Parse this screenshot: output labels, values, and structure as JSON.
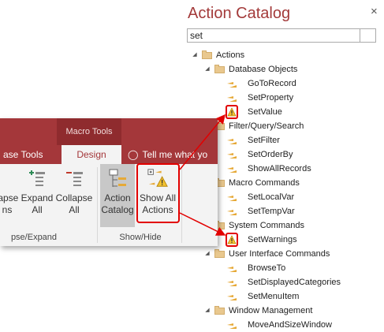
{
  "catalog": {
    "title": "Action Catalog",
    "close_glyph": "×",
    "search_value": "set",
    "tree": [
      {
        "label": "Actions",
        "kind": "folder",
        "level": 0,
        "expanded": true
      },
      {
        "label": "Database Objects",
        "kind": "folder",
        "level": 1,
        "expanded": true
      },
      {
        "label": "GoToRecord",
        "kind": "action",
        "level": 2
      },
      {
        "label": "SetProperty",
        "kind": "action",
        "level": 2
      },
      {
        "label": "SetValue",
        "kind": "action",
        "level": 2,
        "unsafe": true
      },
      {
        "label": "Filter/Query/Search",
        "kind": "folder",
        "level": 1,
        "expanded": true
      },
      {
        "label": "SetFilter",
        "kind": "action",
        "level": 2
      },
      {
        "label": "SetOrderBy",
        "kind": "action",
        "level": 2
      },
      {
        "label": "ShowAllRecords",
        "kind": "action",
        "level": 2
      },
      {
        "label": "Macro Commands",
        "kind": "folder",
        "level": 1,
        "expanded": true
      },
      {
        "label": "SetLocalVar",
        "kind": "action",
        "level": 2
      },
      {
        "label": "SetTempVar",
        "kind": "action",
        "level": 2
      },
      {
        "label": "System Commands",
        "kind": "folder",
        "level": 1,
        "expanded": true
      },
      {
        "label": "SetWarnings",
        "kind": "action",
        "level": 2,
        "unsafe": true
      },
      {
        "label": "User Interface Commands",
        "kind": "folder",
        "level": 1,
        "expanded": true
      },
      {
        "label": "BrowseTo",
        "kind": "action",
        "level": 2
      },
      {
        "label": "SetDisplayedCategories",
        "kind": "action",
        "level": 2
      },
      {
        "label": "SetMenuItem",
        "kind": "action",
        "level": 2
      },
      {
        "label": "Window Management",
        "kind": "folder",
        "level": 1,
        "expanded": true
      },
      {
        "label": "MoveAndSizeWindow",
        "kind": "action",
        "level": 2
      }
    ]
  },
  "ribbon": {
    "contextual_tab": "Macro Tools",
    "tab_database_tools": "ase Tools",
    "tab_design": "Design",
    "tell_me": "Tell me what yo",
    "buttons": {
      "collapse_actions_l1": "lapse",
      "collapse_actions_l2": "ns",
      "expand_all_l1": "Expand",
      "expand_all_l2": "All",
      "collapse_all_l1": "Collapse",
      "collapse_all_l2": "All",
      "action_catalog_l1": "Action",
      "action_catalog_l2": "Catalog",
      "show_all_actions_l1": "Show All",
      "show_all_actions_l2": "Actions"
    },
    "group_collapse_expand": "pse/Expand",
    "group_show_hide": "Show/Hide"
  },
  "colors": {
    "accent": "#a4373a",
    "title": "#a33a3a",
    "highlight": "#e20000",
    "folder": "#e9c88e",
    "warning": "#f2c230"
  }
}
